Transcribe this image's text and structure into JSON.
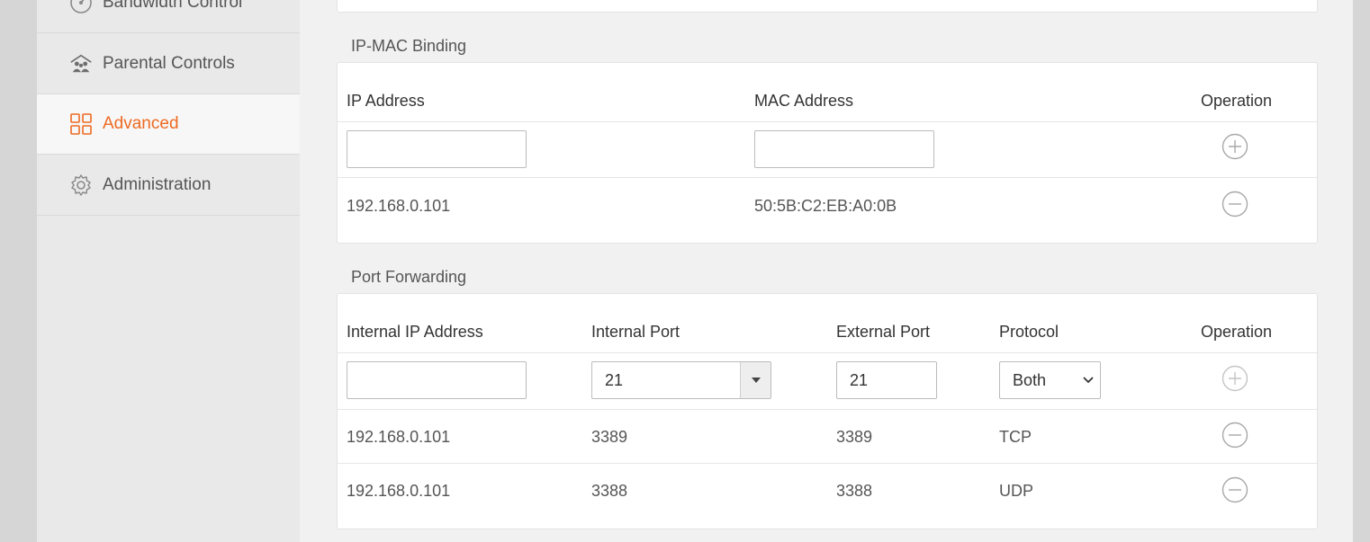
{
  "sidebar": {
    "items": [
      {
        "label": "Bandwidth Control",
        "icon": "gauge-icon",
        "active": false
      },
      {
        "label": "Parental Controls",
        "icon": "family-icon",
        "active": false
      },
      {
        "label": "Advanced",
        "icon": "grid-icon",
        "active": true
      },
      {
        "label": "Administration",
        "icon": "gear-icon",
        "active": false
      }
    ]
  },
  "ip_mac": {
    "title": "IP-MAC Binding",
    "headers": {
      "ip": "IP Address",
      "mac": "MAC Address",
      "op": "Operation"
    },
    "new_row": {
      "ip": "",
      "mac": ""
    },
    "rows": [
      {
        "ip": "192.168.0.101",
        "mac": "50:5B:C2:EB:A0:0B"
      }
    ]
  },
  "port_forwarding": {
    "title": "Port Forwarding",
    "headers": {
      "internal_ip": "Internal IP Address",
      "internal_port": "Internal Port",
      "external_port": "External Port",
      "protocol": "Protocol",
      "op": "Operation"
    },
    "new_row": {
      "internal_ip": "",
      "internal_port": "21",
      "external_port": "21",
      "protocol": "Both"
    },
    "rows": [
      {
        "internal_ip": "192.168.0.101",
        "internal_port": "3389",
        "external_port": "3389",
        "protocol": "TCP"
      },
      {
        "internal_ip": "192.168.0.101",
        "internal_port": "3388",
        "external_port": "3388",
        "protocol": "UDP"
      }
    ]
  },
  "colors": {
    "accent": "#ee6a22",
    "icon_gray": "#9a9a9a"
  }
}
